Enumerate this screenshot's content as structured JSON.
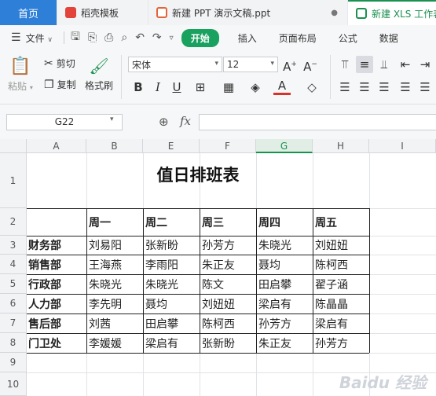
{
  "tabs": [
    {
      "label": "首页"
    },
    {
      "label": "稻壳模板"
    },
    {
      "label": "新建 PPT 演示文稿.ppt"
    },
    {
      "label": "新建 XLS 工作表"
    }
  ],
  "menu": {
    "file": "文件",
    "start": "开始",
    "insert": "插入",
    "page_layout": "页面布局",
    "formula": "公式",
    "data": "数据"
  },
  "ribbon": {
    "paste": "粘贴",
    "cut": "剪切",
    "copy": "复制",
    "format_painter": "格式刷",
    "font_name": "宋体",
    "font_size": "12",
    "grow": "A⁺",
    "shrink": "A⁻"
  },
  "formula_bar": {
    "name_box": "G22",
    "fx": "fx"
  },
  "sheet": {
    "columns": [
      "A",
      "B",
      "E",
      "F",
      "G",
      "H",
      "I"
    ],
    "rows": [
      "1",
      "2",
      "3",
      "4",
      "5",
      "6",
      "7",
      "8",
      "9",
      "10"
    ],
    "title": "值日排班表",
    "header": [
      "周一",
      "周二",
      "周三",
      "周四",
      "周五"
    ],
    "data": [
      {
        "dept": "财务部",
        "days": [
          "刘易阳",
          "张新盼",
          "孙芳方",
          "朱晓光",
          "刘妞妞"
        ]
      },
      {
        "dept": "销售部",
        "days": [
          "王海燕",
          "李雨阳",
          "朱正友",
          "聂均",
          "陈柯西"
        ]
      },
      {
        "dept": "行政部",
        "days": [
          "朱晓光",
          "朱晓光",
          "陈文",
          "田启攀",
          "翟子涵"
        ]
      },
      {
        "dept": "人力部",
        "days": [
          "李先明",
          "聂均",
          "刘妞妞",
          "梁启有",
          "陈晶晶"
        ]
      },
      {
        "dept": "售后部",
        "days": [
          "刘茜",
          "田启攀",
          "陈柯西",
          "孙芳方",
          "梁启有"
        ]
      },
      {
        "dept": "门卫处",
        "days": [
          "李媛媛",
          "梁启有",
          "张新盼",
          "朱正友",
          "孙芳方"
        ]
      }
    ]
  },
  "watermark": "Baidu 经验"
}
